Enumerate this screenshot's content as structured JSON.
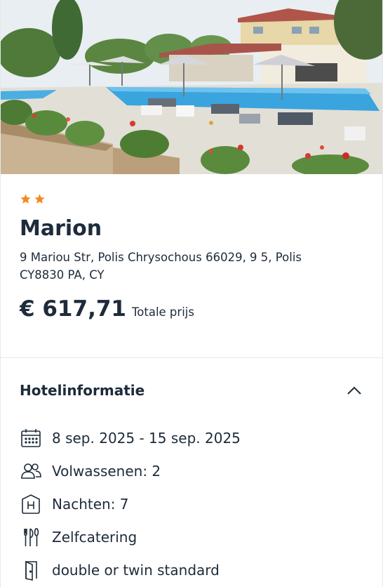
{
  "hotel": {
    "stars": 2,
    "name": "Marion",
    "address": "9 Mariou Str, Polis Chrysochous 66029, 9 5, Polis CY8830 PA, CY",
    "price": "€ 617,71",
    "price_label": "Totale prijs",
    "star_color": "#f08a24"
  },
  "hotel_info": {
    "title": "Hotelinformatie",
    "expanded": true,
    "items": [
      {
        "icon": "calendar-icon",
        "text": "8 sep. 2025 - 15 sep. 2025"
      },
      {
        "icon": "adults-icon",
        "text": "Volwassenen: 2"
      },
      {
        "icon": "hotel-icon",
        "text": "Nachten: 7"
      },
      {
        "icon": "cutlery-icon",
        "text": "Zelfcatering"
      },
      {
        "icon": "door-icon",
        "text": "double or twin standard"
      }
    ]
  }
}
